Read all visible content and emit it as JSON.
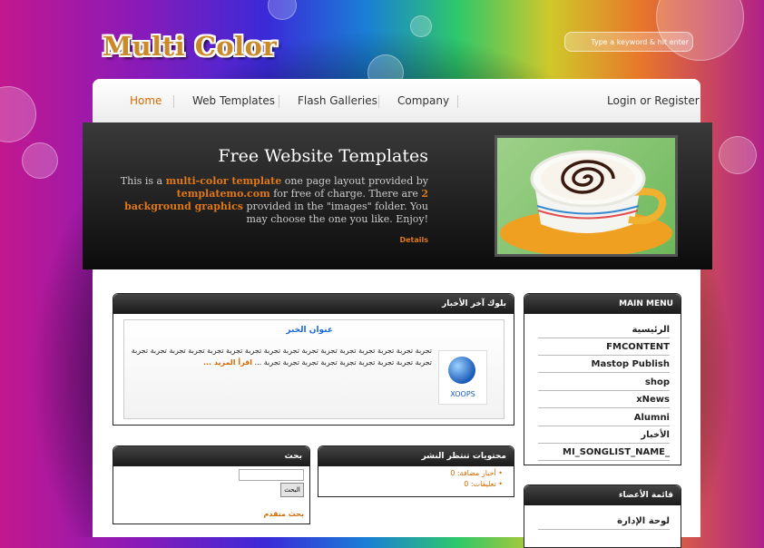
{
  "header": {
    "logo": "Multi Color",
    "search_placeholder": "Type a keyword & hit enter"
  },
  "nav": {
    "home": "Home",
    "web_templates": "Web Templates",
    "flash_galleries": "Flash Galleries",
    "company": "Company",
    "login": "Login or Register"
  },
  "banner": {
    "title": "Free Website Templates",
    "t1": "This is a ",
    "b1": "multi-color template",
    "t2": " one page layout provided by ",
    "b2": "templatemo.com",
    "t3": " for free of charge. There are ",
    "b3": "2 background graphics",
    "t4": " provided in the \"images\" folder. You may choose the one you like. Enjoy!",
    "details": "Details"
  },
  "news_block": {
    "title": "بلوك آخر الأخبار",
    "headline": "عنوان الخبر",
    "body": "تجربة تجربة تجربة تجربة تجربة تجربة تجربة تجربة تجربة تجربة تجربة تجربة تجربة تجربة تجربة تجربة تجربة تجربة تجربة تجربة تجربة تجربة تجربة تجربة تجربة ...",
    "read_more": "اقرأ المزيد ...",
    "logo_text": "XOOPS"
  },
  "main_menu": {
    "title": "MAIN MENU",
    "items": [
      "الرئيسية",
      "FMCONTENT",
      "Mastop Publish",
      "shop",
      "xNews",
      "Alumni",
      "الأخبار",
      "MI_SONGLIST_NAME_"
    ]
  },
  "search_block": {
    "title": "بحث",
    "button": "البحث",
    "advanced": "بحث متقدم"
  },
  "pending_block": {
    "title": "محتويات تنتظر النشر",
    "items": [
      "أخبار مضافة: 0",
      "تعليقات: 0"
    ]
  },
  "members_block": {
    "title": "قائمة الأعضاء",
    "items": [
      "لوحة الإدارة"
    ]
  },
  "colors": {
    "accent": "#e07818",
    "link": "#d46a00"
  }
}
